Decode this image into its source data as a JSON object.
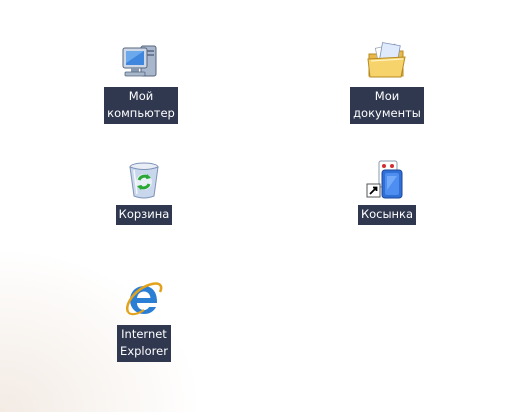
{
  "desktop": {
    "icons": [
      {
        "id": "my-computer",
        "label": "Мой\nкомпьютер",
        "icon": "computer-icon"
      },
      {
        "id": "my-documents",
        "label": "Мои\nдокументы",
        "icon": "folder-documents-icon"
      },
      {
        "id": "recycle-bin",
        "label": "Корзина",
        "icon": "recycle-bin-icon"
      },
      {
        "id": "solitaire",
        "label": "Косынка",
        "icon": "solitaire-shortcut-icon"
      },
      {
        "id": "internet-explorer",
        "label": "Internet\nExplorer",
        "icon": "internet-explorer-icon"
      }
    ]
  }
}
